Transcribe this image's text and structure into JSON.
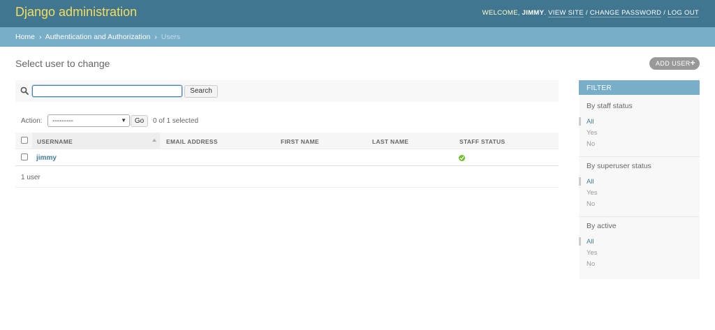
{
  "header": {
    "site_name": "Django administration",
    "welcome": "Welcome,",
    "username": "jimmy",
    "view_site": "View site",
    "change_password": "Change password",
    "log_out": "Log out",
    "sep": "/"
  },
  "breadcrumbs": {
    "home": "Home",
    "app": "Authentication and Authorization",
    "current": "Users",
    "sep": "›"
  },
  "page": {
    "title": "Select user to change",
    "add_button": "Add user",
    "add_icon": "plus-icon"
  },
  "search": {
    "value": "",
    "button": "Search",
    "icon": "search-icon"
  },
  "actions": {
    "label": "Action:",
    "selected_option": "---------",
    "go": "Go",
    "selected_count": "0 of 1 selected"
  },
  "table": {
    "columns": [
      "Username",
      "Email address",
      "First name",
      "Last name",
      "Staff status"
    ],
    "rows": [
      {
        "username": "jimmy",
        "email": "",
        "first_name": "",
        "last_name": "",
        "staff_status": true
      }
    ],
    "paginator": "1 user"
  },
  "filter": {
    "title": "Filter",
    "groups": [
      {
        "title": "By staff status",
        "options": [
          "All",
          "Yes",
          "No"
        ],
        "selected": "All"
      },
      {
        "title": "By superuser status",
        "options": [
          "All",
          "Yes",
          "No"
        ],
        "selected": "All"
      },
      {
        "title": "By active",
        "options": [
          "All",
          "Yes",
          "No"
        ],
        "selected": "All"
      }
    ]
  },
  "colors": {
    "header_bg": "#417690",
    "breadcrumb_bg": "#79aec8",
    "site_name": "#f5dd5d",
    "link": "#447e9b",
    "success": "#70bf2b"
  }
}
